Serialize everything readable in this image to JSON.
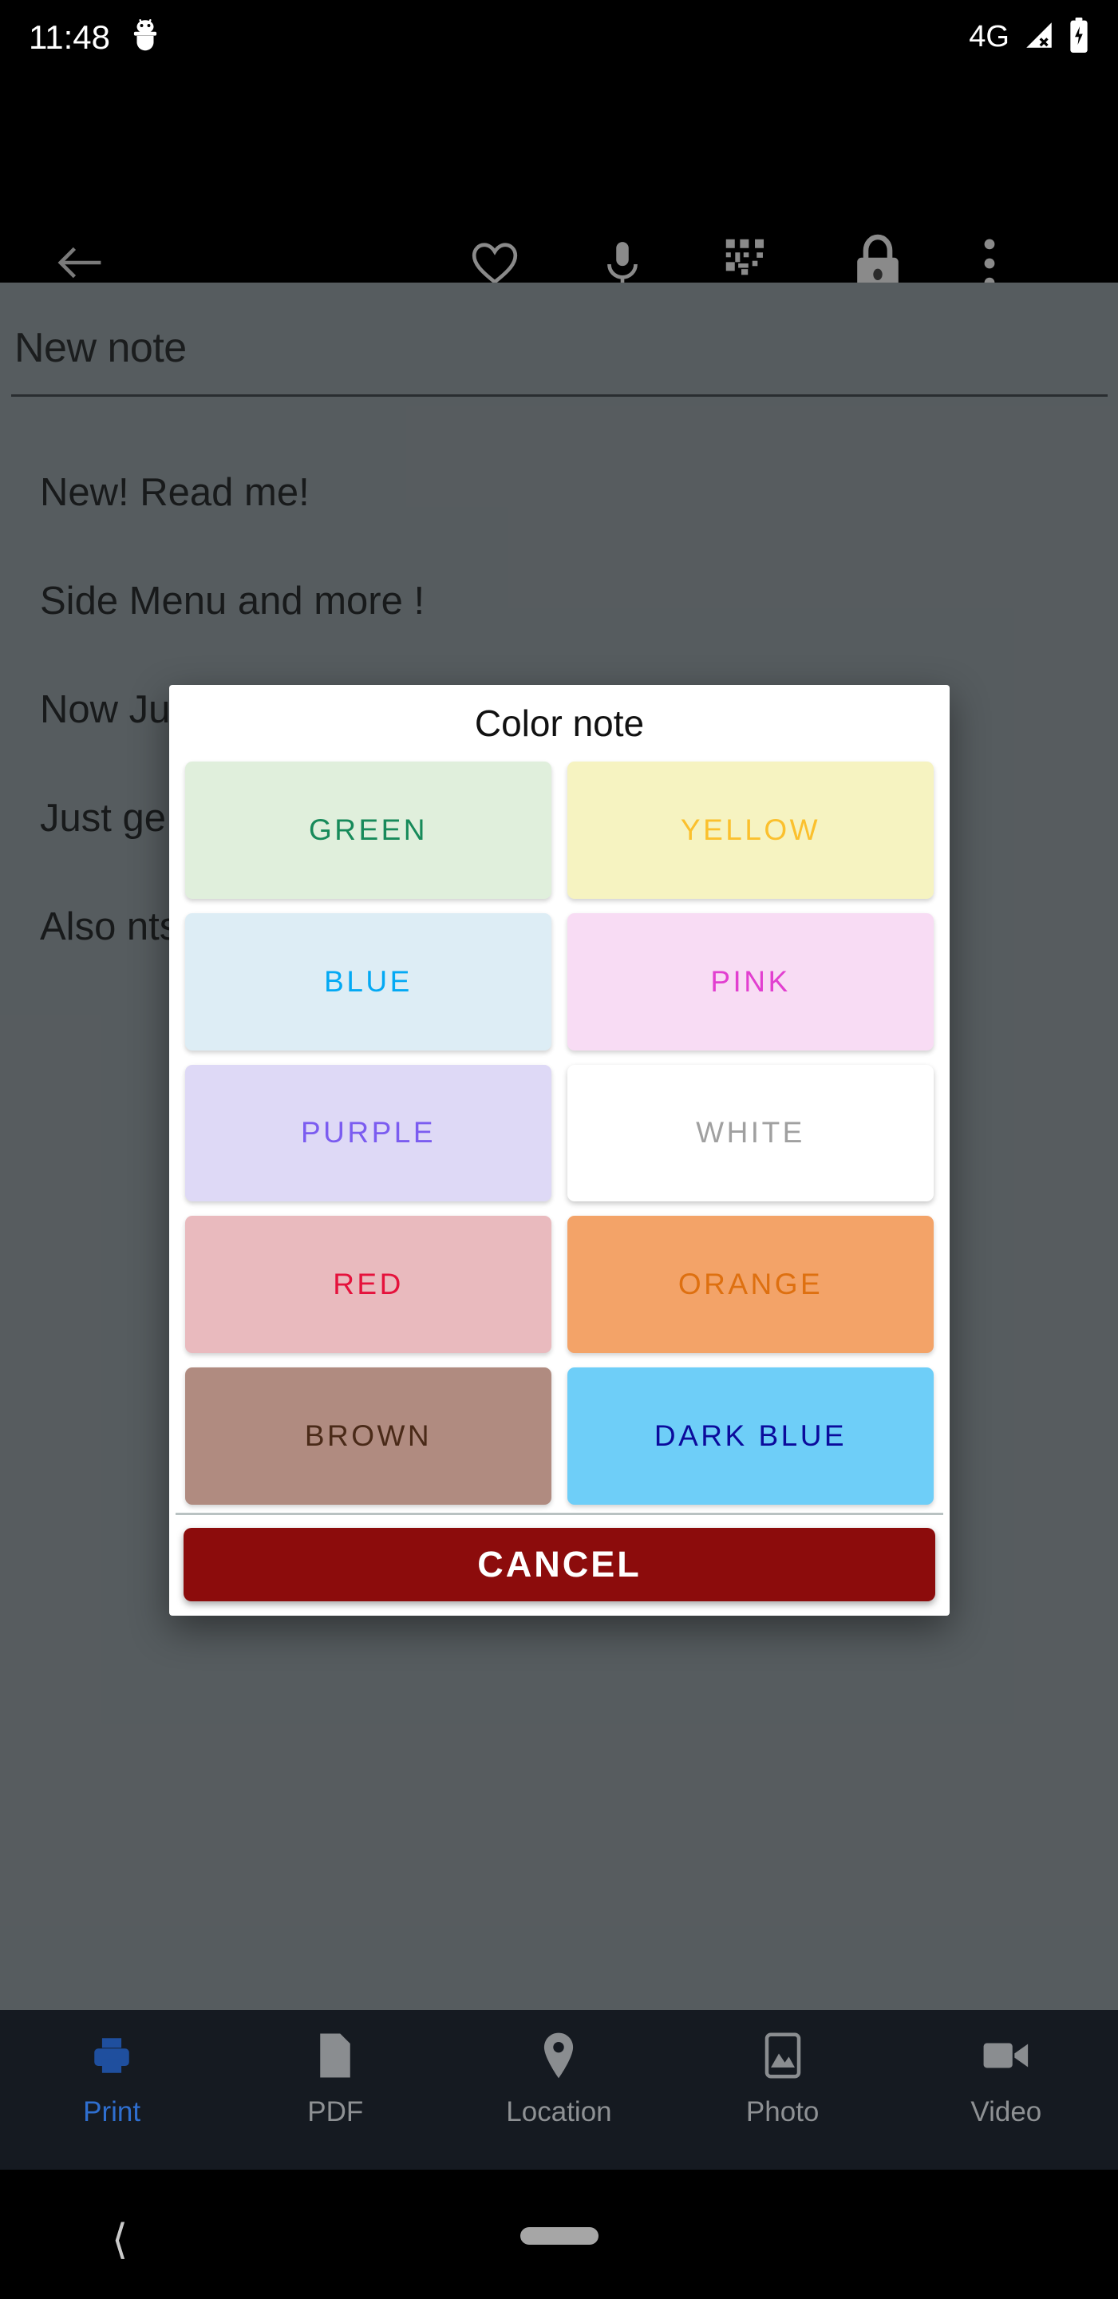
{
  "status_bar": {
    "time": "11:48",
    "bug_icon": "android-bug-icon",
    "network": "4G",
    "signal_icon": "signal-no-connection-icon",
    "battery_icon": "battery-charging-icon"
  },
  "toolbar": {
    "back": "back-arrow-icon",
    "items": [
      {
        "name": "favorite-icon",
        "label": "Favorite"
      },
      {
        "name": "microphone-icon",
        "label": "Voice"
      },
      {
        "name": "qr-code-icon",
        "label": "QR code"
      },
      {
        "name": "lock-icon",
        "label": "Lock"
      },
      {
        "name": "overflow-menu-icon",
        "label": "More options"
      }
    ]
  },
  "note": {
    "title": "New note",
    "body": [
      "New! Read me!",
      "Side Menu and more !",
      "Now                                        Just s                                     he menu                                      ur profil",
      "Just                                    ge to chang",
      "Also                                       nts calen                                       pp and a"
    ]
  },
  "dialog": {
    "title": "Color note",
    "colors": [
      {
        "label": "GREEN",
        "bg": "#e0efdc",
        "fg": "#178a5a"
      },
      {
        "label": "YELLOW",
        "bg": "#f6f3c1",
        "fg": "#fbc02d"
      },
      {
        "label": "BLUE",
        "bg": "#ddedf5",
        "fg": "#03a9f4"
      },
      {
        "label": "PINK",
        "bg": "#f8dcf4",
        "fg": "#e23fd0"
      },
      {
        "label": "PURPLE",
        "bg": "#ded9f6",
        "fg": "#7b5cf0"
      },
      {
        "label": "WHITE",
        "bg": "#ffffff",
        "fg": "#a0a0a0"
      },
      {
        "label": "RED",
        "bg": "#e9babe",
        "fg": "#e5123c"
      },
      {
        "label": "ORANGE",
        "bg": "#f3a368",
        "fg": "#de7010"
      },
      {
        "label": "BROWN",
        "bg": "#b08b80",
        "fg": "#4a2a18"
      },
      {
        "label": "DARK BLUE",
        "bg": "#6ecef8",
        "fg": "#0b0b9c"
      }
    ],
    "cancel_label": "CANCEL",
    "cancel_bg": "#8c0c0c",
    "cancel_fg": "#ffffff"
  },
  "bottom_nav": {
    "items": [
      {
        "label": "Print",
        "icon": "print-icon",
        "active": true
      },
      {
        "label": "PDF",
        "icon": "pdf-icon",
        "active": false
      },
      {
        "label": "Location",
        "icon": "location-pin-icon",
        "active": false
      },
      {
        "label": "Photo",
        "icon": "photo-icon",
        "active": false
      },
      {
        "label": "Video",
        "icon": "video-camera-icon",
        "active": false
      }
    ],
    "active_color": "#2f6fd0",
    "inactive_color": "#8e9194"
  },
  "system_nav": {
    "back": "system-back-chevron",
    "home": "home-pill"
  },
  "theme": {
    "dim_background": "#5c6265",
    "toolbar_background": "#000000",
    "bottom_nav_background": "#151a21"
  }
}
